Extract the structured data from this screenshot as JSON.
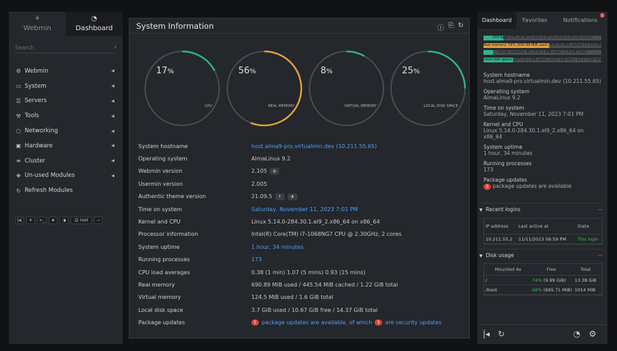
{
  "sidebar": {
    "tabs": [
      {
        "label": "Webmin",
        "icon": "webmin-logo-icon"
      },
      {
        "label": "Dashboard",
        "icon": "dashboard-gauge-icon"
      }
    ],
    "search_placeholder": "Search",
    "items": [
      {
        "label": "Webmin",
        "icon": "gear-icon"
      },
      {
        "label": "System",
        "icon": "laptop-icon"
      },
      {
        "label": "Servers",
        "icon": "list-icon"
      },
      {
        "label": "Tools",
        "icon": "wrench-icon"
      },
      {
        "label": "Networking",
        "icon": "network-icon"
      },
      {
        "label": "Hardware",
        "icon": "hardware-icon"
      },
      {
        "label": "Cluster",
        "icon": "cluster-icon"
      },
      {
        "label": "Un-used Modules",
        "icon": "puzzle-icon"
      },
      {
        "label": "Refresh Modules",
        "icon": "refresh-icon"
      }
    ],
    "tool_user": "root"
  },
  "main": {
    "title": "System Information",
    "gauges": [
      {
        "pct": "17",
        "label": "CPU",
        "value": 17,
        "color": "#2fb38a"
      },
      {
        "pct": "56",
        "label": "REAL MEMORY",
        "value": 56,
        "color": "#e0a040"
      },
      {
        "pct": "8",
        "label": "VIRTUAL MEMORY",
        "value": 8,
        "color": "#2fb38a"
      },
      {
        "pct": "25",
        "label": "LOCAL DISK SPACE",
        "value": 25,
        "color": "#2fb38a"
      }
    ],
    "pct_sign": "%",
    "rows": {
      "hostname": {
        "k": "System hostname",
        "v": "host.alma9-pro.virtualmin.dev (10.211.55.65)"
      },
      "os": {
        "k": "Operating system",
        "v": "AlmaLinux 9.2"
      },
      "webmin": {
        "k": "Webmin version",
        "v": "2.105"
      },
      "usermin": {
        "k": "Usermin version",
        "v": "2.005"
      },
      "theme": {
        "k": "Authentic theme version",
        "v": "21.09.5"
      },
      "time": {
        "k": "Time on system",
        "v": "Saturday, November 11, 2023 7:01 PM"
      },
      "kernel": {
        "k": "Kernel and CPU",
        "v": "Linux 5.14.0-284.30.1.el9_2.x86_64 on x86_64"
      },
      "cpu": {
        "k": "Processor information",
        "v": "Intel(R) Core(TM) i7-1068NG7 CPU @ 2.30GHz, 2 cores"
      },
      "uptime": {
        "k": "System uptime",
        "v": "1 hour, 34 minutes"
      },
      "procs": {
        "k": "Running processes",
        "v": "173"
      },
      "load": {
        "k": "CPU load averages",
        "v": "0.38 (1 min) 1.07 (5 mins) 0.93 (15 mins)"
      },
      "realmem": {
        "k": "Real memory",
        "v": "690.89 MiB used / 445.54 MiB cached / 1.22 GiB total"
      },
      "virtmem": {
        "k": "Virtual memory",
        "v": "124.5 MiB used / 1.6 GiB total"
      },
      "disk": {
        "k": "Local disk space",
        "v": "3.7 GiB used / 10.67 GiB free / 14.37 GiB total"
      },
      "pkgs": {
        "k": "Package updates",
        "count": "5",
        "mid": "package updates are available, of which",
        "sec": "5",
        "end": "are security updates"
      }
    }
  },
  "right": {
    "tabs": [
      "Dashboard",
      "Favorites",
      "Notifications"
    ],
    "notif_count": "1",
    "bars": [
      {
        "text": "CPU load: 17% (0.38 (1 min) 1.07 (5 mins) 0.93 (15 mins))",
        "value": 17,
        "color": "#2fb38a"
      },
      {
        "text": "Real memory: 56% (690.89 MiB used / 445.54 MiB cached / 1.22 GiB total)",
        "value": 56,
        "color": "#e0a040"
      },
      {
        "text": "Virtual memory: 8% (124.5 MiB used / 1.6 GiB total)",
        "value": 8,
        "color": "#2fb38a"
      },
      {
        "text": "Local disk space: 25% (3.7 GiB used / 10.67 GiB free / 14.37 GiB total)",
        "value": 25,
        "color": "#2fb38a"
      }
    ],
    "info": [
      {
        "k": "System hostname",
        "v": "host.alma9-pro.virtualmin.dev (10.211.55.65)"
      },
      {
        "k": "Operating system",
        "v": "AlmaLinux 9.2"
      },
      {
        "k": "Time on system",
        "v": "Saturday, November 11, 2023 7:01 PM"
      },
      {
        "k": "Kernel and CPU",
        "v": "Linux 5.14.0-284.30.1.el9_2.x86_64 on x86_64"
      },
      {
        "k": "System uptime",
        "v": "1 hour, 34 minutes"
      },
      {
        "k": "Running processes",
        "v": "173"
      }
    ],
    "pkg_k": "Package updates",
    "pkg_count": "5",
    "pkg_v": "package updates are available",
    "logins": {
      "title": "Recent logins",
      "headers": [
        "IP address",
        "Last active at",
        "State"
      ],
      "rows": [
        {
          "ip": "10.211.55.2",
          "at": "11/11/2023 06:59 PM",
          "state": "This login"
        }
      ]
    },
    "disk": {
      "title": "Disk usage",
      "headers": [
        "Mounted As",
        "Free",
        "Total"
      ],
      "rows": [
        {
          "mount": "/",
          "pct": "74%",
          "free": "(9.99 GiB)",
          "total": "13.38 GiB"
        },
        {
          "mount": "/boot",
          "pct": "68%",
          "free": "(695.71 MiB)",
          "total": "1014 MiB"
        }
      ]
    }
  }
}
